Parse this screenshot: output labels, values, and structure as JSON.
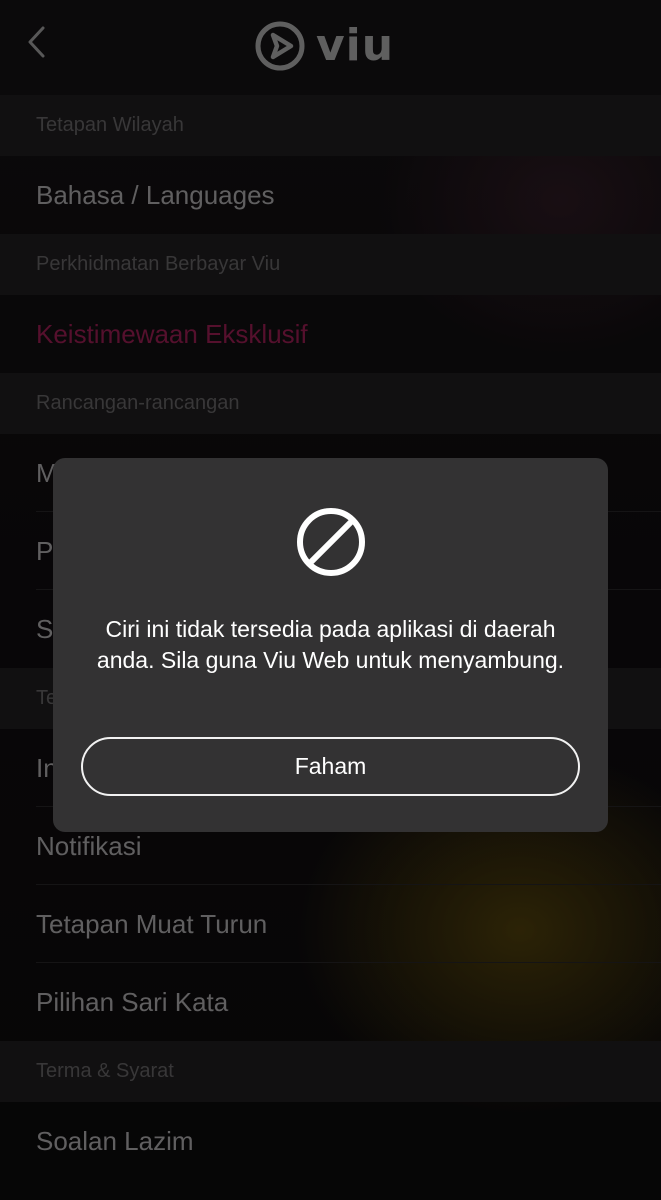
{
  "header": {
    "back_icon": "chevron-left-icon",
    "logo_icon": "play-circle-icon",
    "logo_text": "viu"
  },
  "settings": {
    "sections": [
      {
        "header": "Tetapan Wilayah",
        "items": [
          {
            "label": "Bahasa / Languages"
          }
        ]
      },
      {
        "header": "Perkhidmatan Berbayar Viu",
        "items": [
          {
            "label": "Keistimewaan Eksklusif",
            "accent": true
          }
        ]
      },
      {
        "header": "Rancangan-rancangan",
        "items": [
          {
            "label": "M"
          },
          {
            "label": "P"
          },
          {
            "label": "S"
          }
        ]
      },
      {
        "header": "Te",
        "items": [
          {
            "label": "In"
          },
          {
            "label": "Notifikasi"
          },
          {
            "label": "Tetapan Muat Turun"
          },
          {
            "label": "Pilihan Sari Kata"
          }
        ]
      },
      {
        "header": "Terma & Syarat",
        "items": [
          {
            "label": "Soalan Lazim"
          }
        ]
      }
    ]
  },
  "dialog": {
    "icon": "prohibited-icon",
    "message": "Ciri ini tidak tersedia pada aplikasi di daerah anda. Sila guna Viu Web untuk menyambung.",
    "button_label": "Faham"
  },
  "colors": {
    "accent": "#8a1a49",
    "dialog_bg": "#333233",
    "section_bg": "#1c1a1c"
  }
}
